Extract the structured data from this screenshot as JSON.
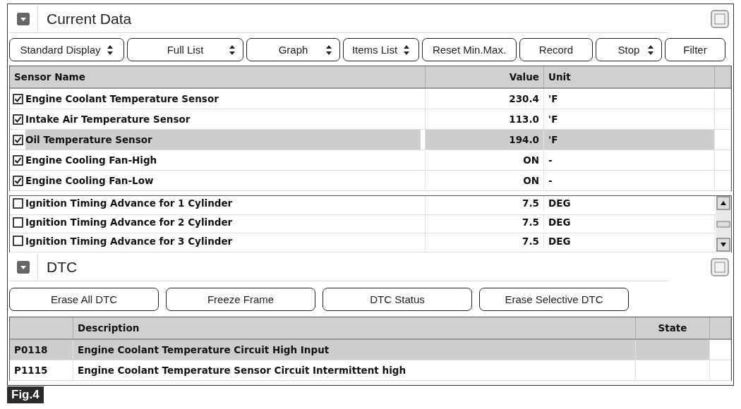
{
  "current_data": {
    "title": "Current Data",
    "toolbar": [
      {
        "label": "Standard Display",
        "kind": "dropdown"
      },
      {
        "label": "Full List",
        "kind": "dropdown"
      },
      {
        "label": "Graph",
        "kind": "dropdown"
      },
      {
        "label": "Items List",
        "kind": "dropdown"
      },
      {
        "label": "Reset Min.Max.",
        "kind": "button"
      },
      {
        "label": "Record",
        "kind": "button"
      },
      {
        "label": "Stop",
        "kind": "dropdown"
      },
      {
        "label": "Filter",
        "kind": "button"
      }
    ],
    "columns": [
      "Sensor Name",
      "Value",
      "Unit"
    ],
    "selected_rows": [
      {
        "name": "Engine Coolant Temperature Sensor",
        "value": "230.4",
        "unit": "'F",
        "checked": true,
        "selected": false
      },
      {
        "name": "Intake Air Temperature Sensor",
        "value": "113.0",
        "unit": "'F",
        "checked": true,
        "selected": false
      },
      {
        "name": "Oil Temperature Sensor",
        "value": "194.0",
        "unit": "'F",
        "checked": true,
        "selected": true
      },
      {
        "name": "Engine Cooling Fan-High",
        "value": "ON",
        "unit": "-",
        "checked": true,
        "selected": false
      },
      {
        "name": "Engine Cooling Fan-Low",
        "value": "ON",
        "unit": "-",
        "checked": true,
        "selected": false
      }
    ],
    "other_rows": [
      {
        "name": "Ignition Timing Advance for 1 Cylinder",
        "value": "7.5",
        "unit": "DEG",
        "checked": false,
        "selected": false
      },
      {
        "name": "Ignition Timing Advance for 2 Cylinder",
        "value": "7.5",
        "unit": "DEG",
        "checked": false,
        "selected": false
      },
      {
        "name": "Ignition Timing Advance for 3 Cylinder",
        "value": "7.5",
        "unit": "DEG",
        "checked": false,
        "selected": false
      }
    ]
  },
  "dtc": {
    "title": "DTC",
    "buttons": [
      "Erase All DTC",
      "Freeze Frame",
      "DTC Status",
      "Erase Selective DTC"
    ],
    "columns": [
      "Description",
      "State"
    ],
    "rows": [
      {
        "code": "P0118",
        "description": "Engine Coolant Temperature Circuit High Input",
        "selected": true
      },
      {
        "code": "P1115",
        "description": "Engine Coolant Temperature Sensor Circuit Intermittent high",
        "selected": false
      }
    ]
  },
  "figure_label": "Fig.4"
}
